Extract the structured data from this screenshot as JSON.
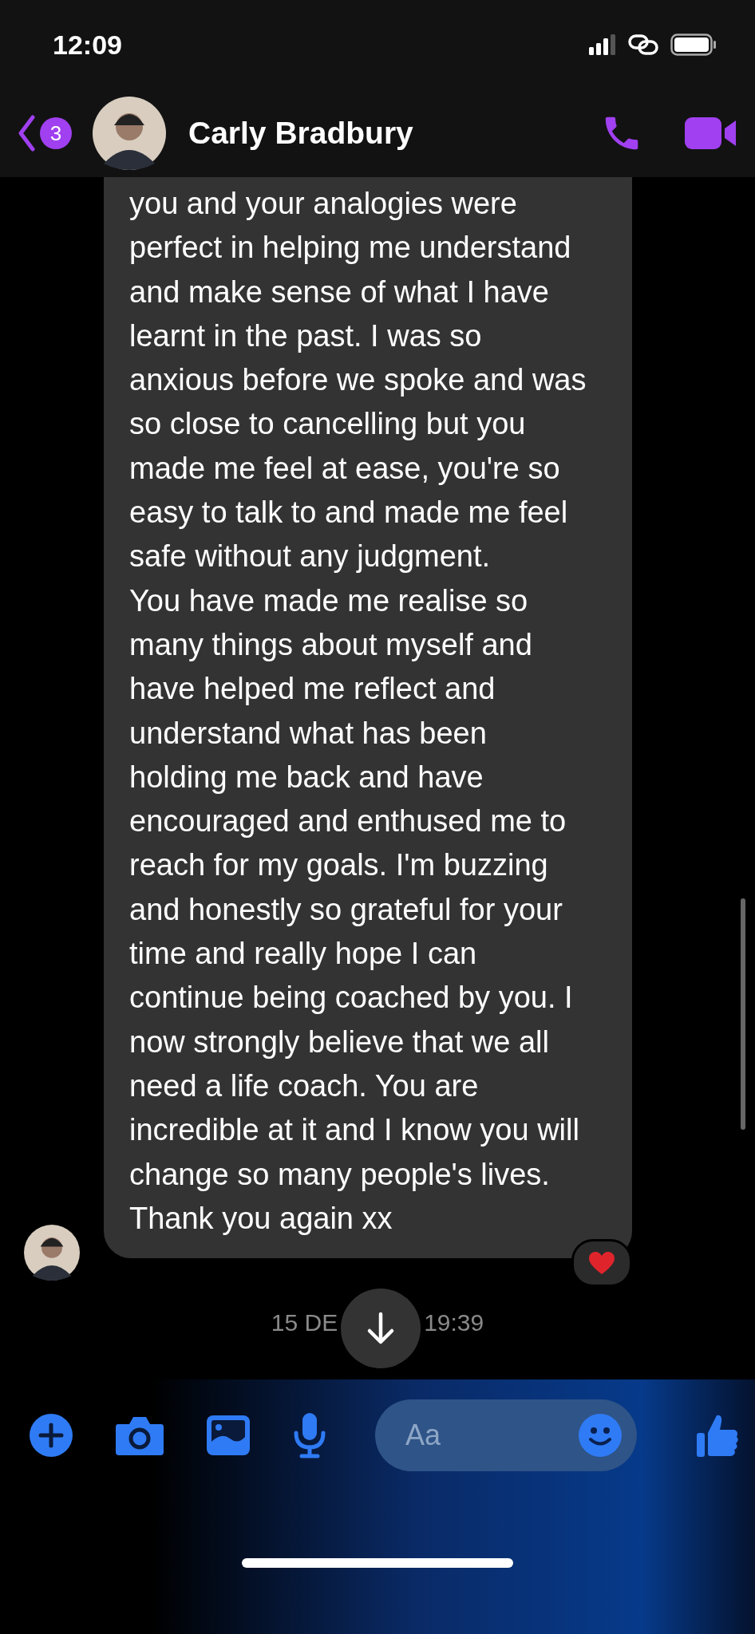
{
  "status_bar": {
    "time": "12:09"
  },
  "header": {
    "unread_count": "3",
    "contact_name": "Carly Bradbury"
  },
  "message": {
    "paragraphs": [
      "you and your analogies were perfect in helping me understand and make sense of what I have learnt in the past. I was so anxious before we spoke and was so close to cancelling but you made me feel at ease, you're so easy to talk to and made me feel safe without any judgment.",
      "You have made me realise so many things about myself and have helped me reflect and understand what has been holding me back and have encouraged and enthused me to reach for my goals. I'm buzzing and honestly so grateful for your time and really hope I can continue being coached by you. I now strongly believe that we all need a life coach.  You are incredible at it and I know you will change so many people's lives.  Thank you again xx"
    ]
  },
  "timestamp": {
    "left": "15 DE",
    "right": "19:39"
  },
  "composer": {
    "placeholder": "Aa"
  }
}
